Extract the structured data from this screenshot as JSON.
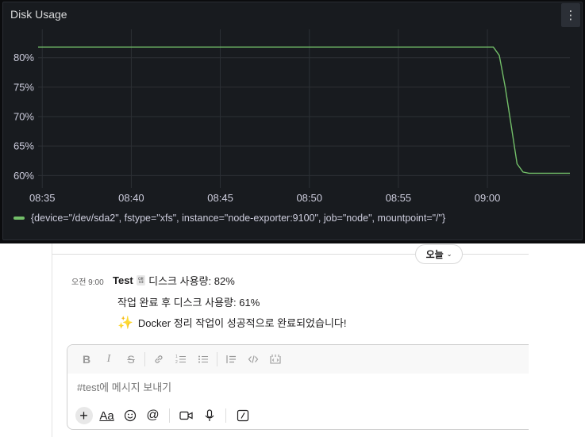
{
  "panel": {
    "title": "Disk Usage",
    "menu_icon": "vertical-dots-icon",
    "legend_label": "{device=\"/dev/sda2\", fstype=\"xfs\", instance=\"node-exporter:9100\", job=\"node\", mountpoint=\"/\"}",
    "series_color": "#73bf69"
  },
  "chart_data": {
    "type": "line",
    "title": "Disk Usage",
    "y_ticks": [
      "60%",
      "65%",
      "70%",
      "75%",
      "80%"
    ],
    "x_ticks": [
      "08:35",
      "08:40",
      "08:45",
      "08:50",
      "08:55",
      "09:00"
    ],
    "ylim": [
      58.7,
      84
    ],
    "xlim": [
      "08:34:46",
      "09:04:38"
    ],
    "grid": true,
    "legend_position": "bottom-left",
    "series": [
      {
        "name": "{device=\"/dev/sda2\", fstype=\"xfs\", instance=\"node-exporter:9100\", job=\"node\", mountpoint=\"/\"}",
        "points": [
          [
            "08:34:46",
            81.8
          ],
          [
            "09:00:00",
            81.8
          ],
          [
            "09:00:20",
            81.8
          ],
          [
            "09:00:40",
            80.4
          ],
          [
            "09:01:00",
            75.0
          ],
          [
            "09:01:20",
            68.5
          ],
          [
            "09:01:40",
            62.0
          ],
          [
            "09:02:00",
            60.6
          ],
          [
            "09:02:20",
            60.4
          ],
          [
            "09:04:38",
            60.4
          ]
        ]
      }
    ]
  },
  "slack": {
    "date_label": "오늘",
    "message": {
      "time": "오전 9:00",
      "author": "Test",
      "app_badge": "앱",
      "line1": "디스크 사용량: 82%",
      "line2": "작업 완료 후 디스크 사용량: 61%",
      "line3_emoji": "✨",
      "line3": "Docker 정리 작업이 성공적으로 완료되었습니다!"
    },
    "composer": {
      "placeholder": "#test에 메시지 보내기",
      "formatting": [
        "bold-icon",
        "italic-icon",
        "strikethrough-icon",
        "link-icon",
        "ordered-list-icon",
        "bulleted-list-icon",
        "blockquote-icon",
        "code-icon",
        "code-block-icon"
      ],
      "actions": [
        "plus-icon",
        "text-format-icon",
        "emoji-icon",
        "mention-icon",
        "video-icon",
        "microphone-icon",
        "shortcut-icon"
      ]
    }
  }
}
